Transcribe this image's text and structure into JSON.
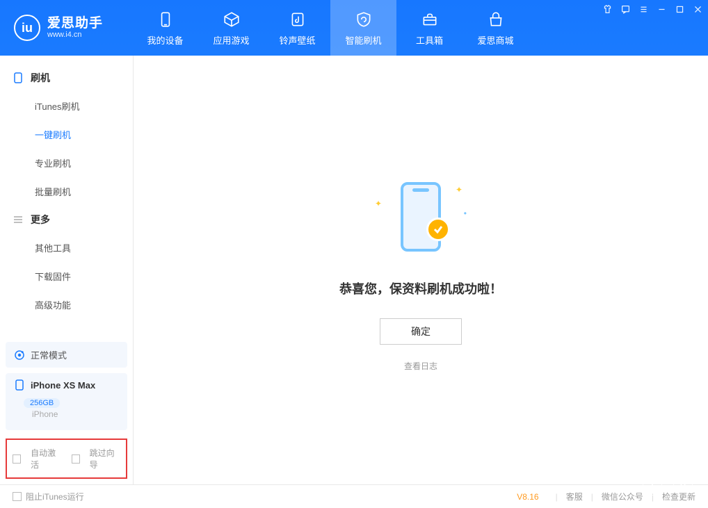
{
  "app": {
    "title": "爱思助手",
    "url": "www.i4.cn"
  },
  "tabs": [
    {
      "label": "我的设备"
    },
    {
      "label": "应用游戏"
    },
    {
      "label": "铃声壁纸"
    },
    {
      "label": "智能刷机"
    },
    {
      "label": "工具箱"
    },
    {
      "label": "爱思商城"
    }
  ],
  "sidebar": {
    "section1": {
      "title": "刷机",
      "items": [
        "iTunes刷机",
        "一键刷机",
        "专业刷机",
        "批量刷机"
      ]
    },
    "section2": {
      "title": "更多",
      "items": [
        "其他工具",
        "下载固件",
        "高级功能"
      ]
    }
  },
  "device": {
    "mode": "正常模式",
    "name": "iPhone XS Max",
    "storage": "256GB",
    "type": "iPhone"
  },
  "bottomChecks": {
    "autoActivate": "自动激活",
    "skipGuide": "跳过向导"
  },
  "main": {
    "successText": "恭喜您，保资料刷机成功啦！",
    "okButton": "确定",
    "viewLog": "查看日志"
  },
  "status": {
    "stopItunes": "阻止iTunes运行",
    "version": "V8.16",
    "support": "客服",
    "wechat": "微信公众号",
    "update": "检查更新"
  }
}
